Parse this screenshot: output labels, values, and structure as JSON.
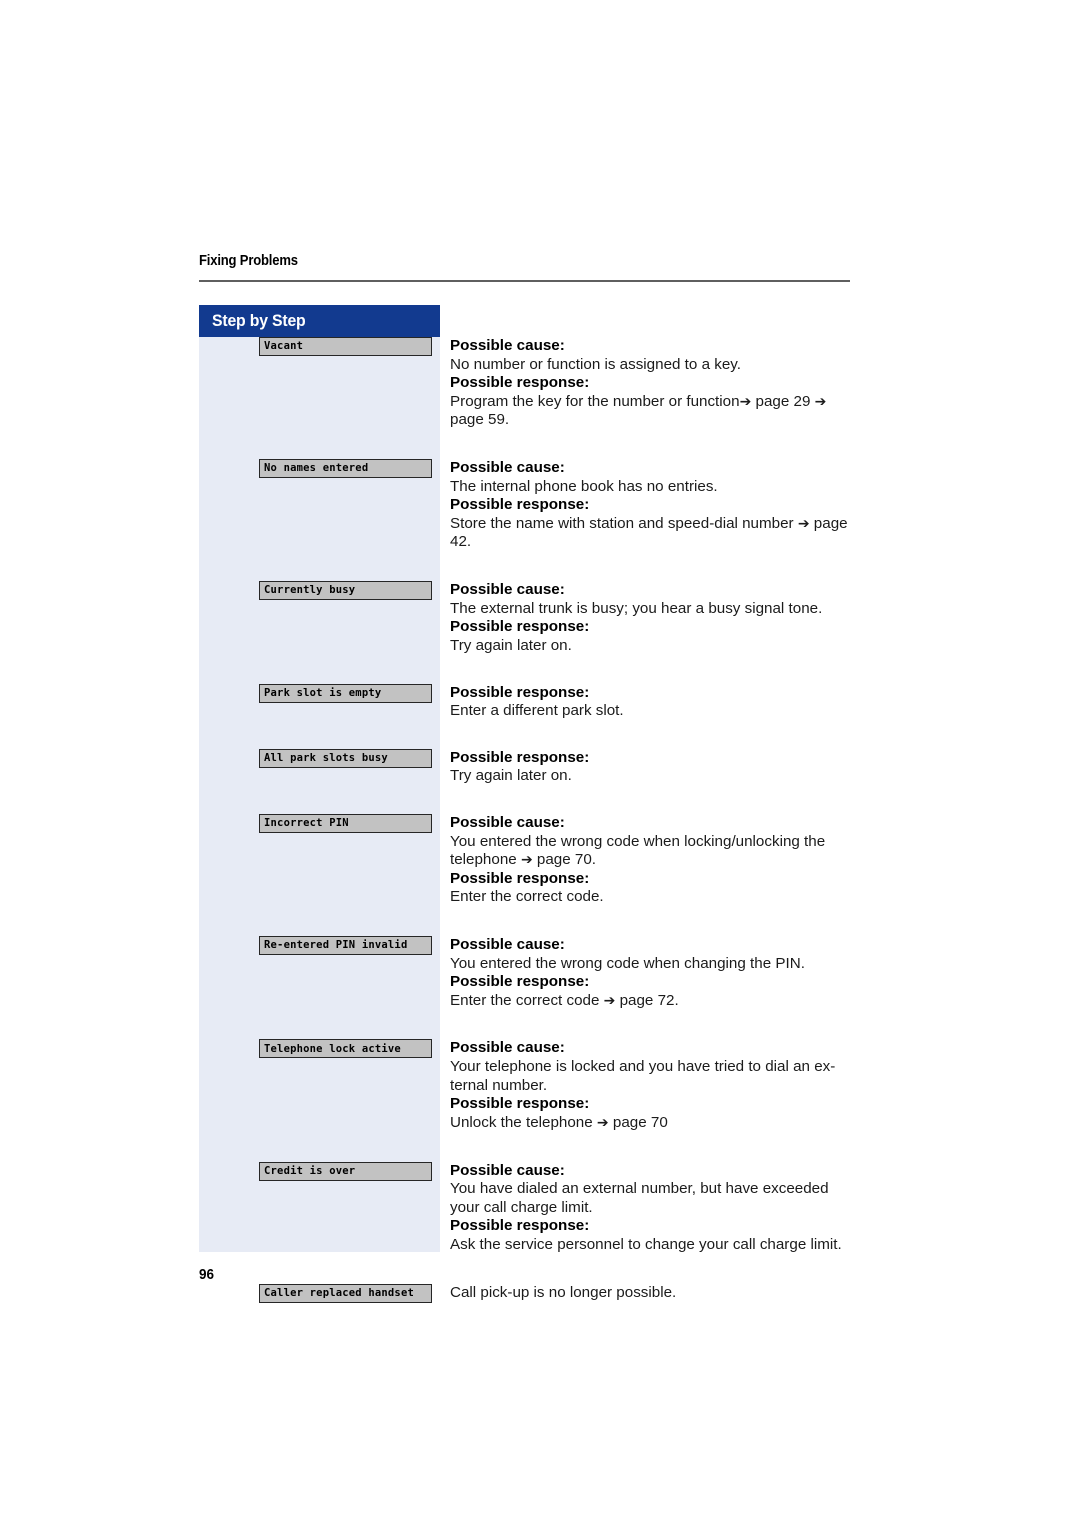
{
  "header": {
    "running_title": "Fixing Problems"
  },
  "sidebar": {
    "title": "Step by Step",
    "accent_color": "#123a8f",
    "background_color": "#e7ebf5",
    "chip_background_color": "#c2c2c2"
  },
  "footer": {
    "page_number": "96"
  },
  "labels": {
    "cause": "Possible cause:",
    "response": "Possible response:"
  },
  "arrow_glyph": "➔",
  "rows": [
    {
      "display": "Vacant",
      "gap_after": 29,
      "blocks": [
        {
          "label": "Possible cause:",
          "text": "No number or function is assigned to a key."
        },
        {
          "label": "Possible response:",
          "text": "Program the key for the number or function➔ page 29 ➔ page 59."
        }
      ]
    },
    {
      "display": "No names entered",
      "gap_after": 29,
      "blocks": [
        {
          "label": "Possible cause:",
          "text": "The internal phone book has no entries."
        },
        {
          "label": "Possible response:",
          "text": "Store the name with station and speed-dial number ➔ page 42."
        }
      ]
    },
    {
      "display": "Currently busy",
      "gap_after": 28,
      "blocks": [
        {
          "label": "Possible cause:",
          "text": "The external trunk is busy; you hear a busy signal tone."
        },
        {
          "label": "Possible response:",
          "text": "Try again later on."
        }
      ]
    },
    {
      "display": "Park slot is empty",
      "gap_after": 28,
      "blocks": [
        {
          "label": "Possible response:",
          "text": "Enter a different park slot."
        }
      ]
    },
    {
      "display": "All park slots busy",
      "gap_after": 28,
      "blocks": [
        {
          "label": "Possible response:",
          "text": "Try again later on."
        }
      ]
    },
    {
      "display": "Incorrect PIN",
      "gap_after": 29,
      "blocks": [
        {
          "label": "Possible cause:",
          "text": "You entered the wrong code when locking/unlocking the telephone ➔ page 70."
        },
        {
          "label": "Possible response:",
          "text": "Enter the correct code."
        }
      ]
    },
    {
      "display": "Re-entered PIN invalid",
      "gap_after": 29,
      "blocks": [
        {
          "label": "Possible cause:",
          "text": "You entered the wrong code when changing the PIN."
        },
        {
          "label": "Possible response:",
          "text": "Enter the correct code ➔ page 72."
        }
      ]
    },
    {
      "display": "Telephone lock active",
      "gap_after": 29,
      "blocks": [
        {
          "label": "Possible cause:",
          "text": "Your telephone is locked and you have tried to dial an ex-ternal number."
        },
        {
          "label": "Possible response:",
          "text": "Unlock the telephone ➔ page 70"
        }
      ]
    },
    {
      "display": "Credit is over",
      "gap_after": 29,
      "blocks": [
        {
          "label": "Possible cause:",
          "text": "You have dialed an external number, but have exceeded your call charge limit."
        },
        {
          "label": "Possible response:",
          "text": "Ask the service personnel to change your call charge limit."
        }
      ]
    },
    {
      "display": "Caller replaced handset",
      "gap_after": 0,
      "blocks": [
        {
          "label": "",
          "text": "Call pick-up is no longer possible."
        }
      ]
    }
  ]
}
